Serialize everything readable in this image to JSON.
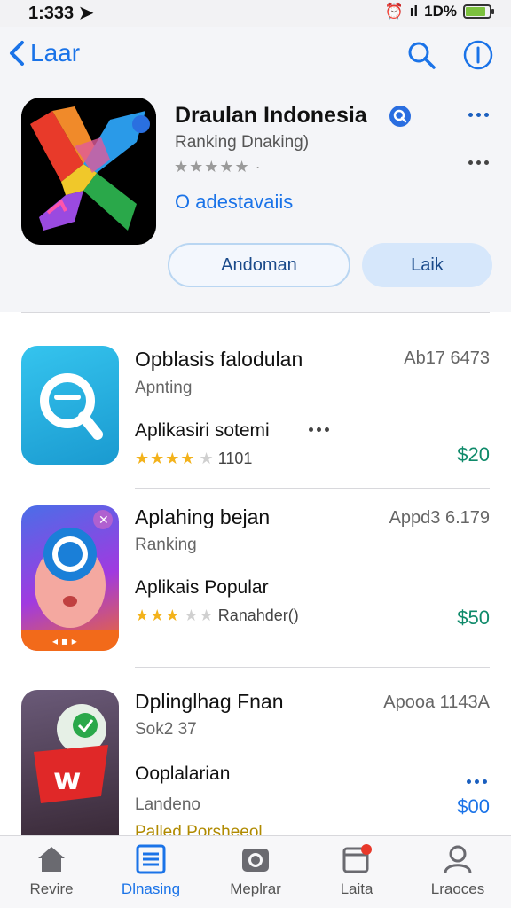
{
  "status": {
    "time": "1:333",
    "battery_label": "1D%",
    "battery_level": 0.85
  },
  "nav": {
    "back_label": "Laar"
  },
  "app": {
    "title": "Draulan Indonesia",
    "subtitle": "Ranking Dnaking)",
    "stars_text": "★★★★★ ·",
    "link": "O adestavaiis",
    "button_primary": "Andoman",
    "button_secondary": "Laik"
  },
  "list": [
    {
      "title": "Opblasis falodulan",
      "subtitle": "Apnting",
      "description": "Aplikasiri sotemi",
      "rating_text": "1101",
      "stars_filled": 4.5,
      "meta": "Ab17 6473",
      "price": "$20",
      "icon": "search-app-icon",
      "color": "#2ab0e0"
    },
    {
      "title": "Aplahing bejan",
      "subtitle": "Ranking",
      "description": "Aplikais Popular",
      "rating_text": "Ranahder()",
      "stars_filled": 3,
      "meta": "Appd3 6.179",
      "price": "$50",
      "icon": "face-app-icon",
      "color": "#7a3fe0"
    },
    {
      "title": "Dplinglhag Fnan",
      "subtitle": "Sok2 37",
      "description": "Ooplalarian",
      "rating_text": "Landeno",
      "extra": "Palled Porsheeol",
      "meta": "Apooa 1143A",
      "price": "$00",
      "icon": "w-app-icon",
      "color": "#d82a2a"
    }
  ],
  "tabs": [
    {
      "label": "Revire",
      "icon": "home-icon"
    },
    {
      "label": "Dlnasing",
      "icon": "list-icon",
      "active": true
    },
    {
      "label": "Meplrar",
      "icon": "camera-icon"
    },
    {
      "label": "Laita",
      "icon": "calendar-icon"
    },
    {
      "label": "Lraoces",
      "icon": "person-icon"
    }
  ],
  "colors": {
    "accent": "#1a73e8",
    "price_green": "#0f8a6a",
    "star_gold": "#f3b21b"
  }
}
